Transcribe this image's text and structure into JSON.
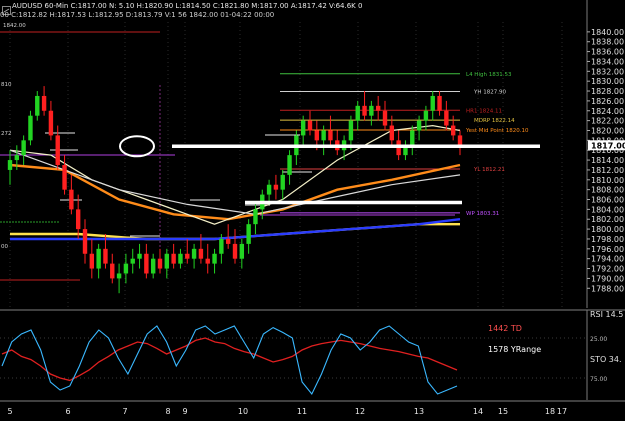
{
  "header": {
    "symbol_line": "AUDUSD 60-Min  C:1817.00  N:  5.10  H:1820.90  L:1814.50  C:1821.80  M:1817.00  A:1817.42  V:64.6K 0",
    "sub_line": "00 C:1812.82  H:1817.53  L:1812.95  D:1813.79  V:1 56  1842.00  01-04:22  00:00"
  },
  "chart_data": {
    "type": "line",
    "title": "",
    "price_axis": {
      "min": 1784,
      "max": 1842,
      "labels": [
        "1840.00",
        "1838.00",
        "1836.00",
        "1834.00",
        "1832.00",
        "1830.00",
        "1828.00",
        "1826.00",
        "1824.00",
        "1822.00",
        "1820.00",
        "1818.00",
        "1816.00",
        "1814.00",
        "1812.00",
        "1810.00",
        "1808.00",
        "1806.00",
        "1804.00",
        "1802.00",
        "1800.00",
        "1798.00",
        "1796.00",
        "1794.00",
        "1792.00",
        "1790.00",
        "1788.00"
      ],
      "last_price_label": "1817.00"
    },
    "time_axis": {
      "labels": [
        "5",
        "6",
        "7",
        "8",
        "9",
        "10",
        "11",
        "12",
        "13",
        "14",
        "15",
        "17",
        "18"
      ]
    },
    "candles": [
      [
        1812,
        1816,
        1809,
        1814
      ],
      [
        1814,
        1817,
        1812,
        1815
      ],
      [
        1815,
        1819,
        1813,
        1818
      ],
      [
        1818,
        1824,
        1817,
        1823
      ],
      [
        1823,
        1828,
        1822,
        1827
      ],
      [
        1827,
        1829,
        1823,
        1824
      ],
      [
        1824,
        1826,
        1818,
        1819
      ],
      [
        1819,
        1821,
        1812,
        1813
      ],
      [
        1813,
        1815,
        1807,
        1808
      ],
      [
        1808,
        1811,
        1803,
        1804
      ],
      [
        1804,
        1807,
        1798,
        1800
      ],
      [
        1800,
        1802,
        1793,
        1795
      ],
      [
        1795,
        1798,
        1790,
        1792
      ],
      [
        1792,
        1797,
        1790,
        1796
      ],
      [
        1796,
        1799,
        1792,
        1793
      ],
      [
        1793,
        1795,
        1789,
        1790
      ],
      [
        1790,
        1793,
        1787,
        1791
      ],
      [
        1791,
        1795,
        1789,
        1793
      ],
      [
        1793,
        1796,
        1791,
        1794
      ],
      [
        1794,
        1797,
        1792,
        1795
      ],
      [
        1795,
        1797,
        1790,
        1791
      ],
      [
        1791,
        1795,
        1790,
        1794
      ],
      [
        1794,
        1796,
        1791,
        1792
      ],
      [
        1792,
        1796,
        1790,
        1795
      ],
      [
        1795,
        1797,
        1792,
        1793
      ],
      [
        1793,
        1796,
        1792,
        1795
      ],
      [
        1795,
        1798,
        1793,
        1794
      ],
      [
        1794,
        1797,
        1792,
        1796
      ],
      [
        1796,
        1799,
        1793,
        1794
      ],
      [
        1794,
        1797,
        1791,
        1793
      ],
      [
        1793,
        1796,
        1791,
        1795
      ],
      [
        1795,
        1799,
        1793,
        1798
      ],
      [
        1798,
        1801,
        1796,
        1797
      ],
      [
        1797,
        1800,
        1793,
        1794
      ],
      [
        1794,
        1798,
        1792,
        1797
      ],
      [
        1797,
        1802,
        1795,
        1801
      ],
      [
        1801,
        1805,
        1799,
        1804
      ],
      [
        1804,
        1808,
        1802,
        1807
      ],
      [
        1807,
        1810,
        1805,
        1809
      ],
      [
        1809,
        1811,
        1806,
        1808
      ],
      [
        1808,
        1812,
        1806,
        1811
      ],
      [
        1811,
        1816,
        1809,
        1815
      ],
      [
        1815,
        1820,
        1813,
        1819
      ],
      [
        1819,
        1823,
        1817,
        1822
      ],
      [
        1822,
        1824,
        1819,
        1820
      ],
      [
        1820,
        1822,
        1816,
        1818
      ],
      [
        1818,
        1821,
        1815,
        1820
      ],
      [
        1820,
        1823,
        1817,
        1818
      ],
      [
        1818,
        1820,
        1815,
        1816
      ],
      [
        1816,
        1819,
        1814,
        1818
      ],
      [
        1818,
        1823,
        1816,
        1822
      ],
      [
        1822,
        1826,
        1820,
        1825
      ],
      [
        1825,
        1828,
        1822,
        1823
      ],
      [
        1823,
        1826,
        1821,
        1825
      ],
      [
        1825,
        1827,
        1822,
        1824
      ],
      [
        1824,
        1826,
        1820,
        1821
      ],
      [
        1821,
        1823,
        1817,
        1818
      ],
      [
        1818,
        1820,
        1814,
        1815
      ],
      [
        1815,
        1818,
        1814,
        1817
      ],
      [
        1817,
        1821,
        1815,
        1820
      ],
      [
        1820,
        1823,
        1818,
        1822
      ],
      [
        1822,
        1825,
        1820,
        1824
      ],
      [
        1824,
        1828,
        1822,
        1827
      ],
      [
        1827,
        1828,
        1823,
        1824
      ],
      [
        1824,
        1826,
        1820,
        1821
      ],
      [
        1821,
        1823,
        1818,
        1819
      ],
      [
        1819,
        1820,
        1815,
        1817
      ]
    ],
    "moving_averages": [
      {
        "color": "#ff8c1a",
        "points": [
          [
            0,
            1813
          ],
          [
            8,
            1812
          ],
          [
            16,
            1806
          ],
          [
            24,
            1803
          ],
          [
            32,
            1802
          ],
          [
            40,
            1804
          ],
          [
            48,
            1808
          ],
          [
            56,
            1810
          ],
          [
            66,
            1813
          ]
        ]
      },
      {
        "color": "#ffe14d",
        "points": [
          [
            0,
            1799
          ],
          [
            10,
            1799
          ],
          [
            20,
            1798
          ],
          [
            30,
            1798
          ],
          [
            40,
            1799
          ],
          [
            50,
            1800
          ],
          [
            60,
            1801
          ],
          [
            66,
            1801
          ]
        ]
      },
      {
        "color": "#2a3cff",
        "points": [
          [
            0,
            1798
          ],
          [
            10,
            1798
          ],
          [
            20,
            1798
          ],
          [
            30,
            1798
          ],
          [
            40,
            1799
          ],
          [
            50,
            1800
          ],
          [
            60,
            1801
          ],
          [
            66,
            1802
          ]
        ]
      },
      {
        "color": "#f4f0c8",
        "points": [
          [
            0,
            1816
          ],
          [
            6,
            1815
          ],
          [
            12,
            1810
          ],
          [
            20,
            1806
          ],
          [
            30,
            1801
          ],
          [
            40,
            1806
          ],
          [
            48,
            1814
          ],
          [
            56,
            1820
          ],
          [
            62,
            1821
          ],
          [
            66,
            1820
          ]
        ]
      },
      {
        "color": "#d9d9d9",
        "points": [
          [
            0,
            1816
          ],
          [
            8,
            1812
          ],
          [
            16,
            1808
          ],
          [
            26,
            1805
          ],
          [
            36,
            1803
          ],
          [
            46,
            1806
          ],
          [
            56,
            1809
          ],
          [
            66,
            1811
          ]
        ]
      }
    ],
    "level_lines": [
      {
        "label": "L4 High 1831.53",
        "price": 1831.5,
        "color": "#3fbf3f"
      },
      {
        "label": "YH 1827.90",
        "price": 1827.9,
        "color": "#cfcfcf"
      },
      {
        "label": "HR1 1824.11",
        "price": 1824.1,
        "color": "#c02020"
      },
      {
        "label": "MDRP 1822.14",
        "price": 1822.1,
        "color": "#e0c040"
      },
      {
        "label": "Yest Mid Point 1820.10",
        "price": 1820.1,
        "color": "#ff8c1a"
      },
      {
        "label": "YL 1812.21",
        "price": 1812.2,
        "color": "#e04040"
      },
      {
        "label": "WP 1803.31",
        "price": 1803.3,
        "color": "#c050ff"
      }
    ],
    "left_markers": [
      "1842.00",
      "810",
      "272",
      "00"
    ],
    "indicator": {
      "labels": [
        "1442 TD",
        "1578 YRange"
      ],
      "rsi_label": "RSI  14.5",
      "sto_label": "STO  34.",
      "ticks": [
        "25.00",
        "75.00"
      ],
      "rsi_series": [
        55,
        60,
        52,
        48,
        40,
        30,
        25,
        22,
        28,
        35,
        45,
        52,
        60,
        65,
        70,
        68,
        62,
        55,
        60,
        65,
        72,
        75,
        70,
        68,
        62,
        58,
        55,
        50,
        45,
        48,
        52,
        60,
        65,
        68,
        70,
        72,
        70,
        68,
        65,
        62,
        60,
        58,
        55,
        52,
        50,
        45,
        40,
        35
      ],
      "sto_series": [
        40,
        70,
        80,
        85,
        60,
        20,
        10,
        15,
        40,
        70,
        85,
        75,
        50,
        30,
        55,
        80,
        90,
        70,
        40,
        60,
        85,
        90,
        80,
        85,
        90,
        70,
        50,
        80,
        88,
        82,
        75,
        20,
        5,
        30,
        60,
        80,
        75,
        60,
        70,
        85,
        90,
        80,
        70,
        65,
        20,
        5,
        10,
        15
      ]
    }
  }
}
